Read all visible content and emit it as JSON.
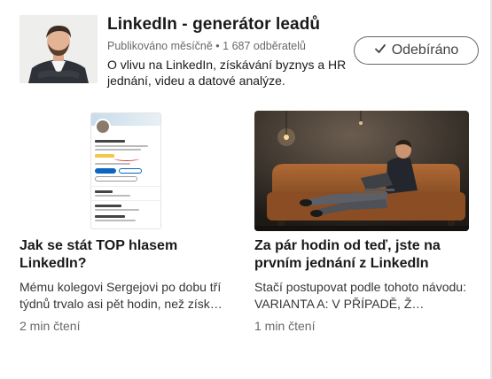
{
  "newsletter": {
    "title": "LinkedIn - generátor leadů",
    "meta": "Publikováno měsíčně • 1 687 odběratelů",
    "description": "O vlivu na LinkedIn, získávání byznys a HR jednání, videu a datové analýze.",
    "follow_label": "Odebíráno",
    "follow_icon": "check-icon"
  },
  "articles": [
    {
      "title": "Jak se stát TOP hlasem LinkedIn?",
      "excerpt": "Mému kolegovi Sergejovi po dobu tří týdnů trvalo asi pět hodin, než získ…",
      "read_time": "2 min čtení"
    },
    {
      "title": "Za pár hodin od teď, jste na prvním jednání z LinkedIn",
      "excerpt": "Stačí postupovat podle tohoto návodu: VARIANTA A: V PŘÍPADĚ, Ž…",
      "read_time": "1 min čtení"
    }
  ],
  "colors": {
    "accent": "#0a66c2",
    "text": "#191919",
    "muted": "#666666"
  }
}
